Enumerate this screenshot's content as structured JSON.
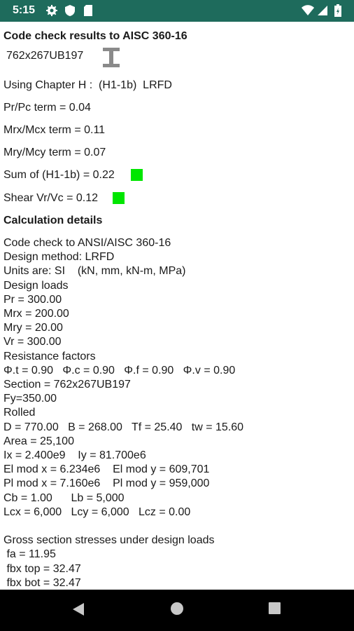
{
  "status_bar": {
    "time": "5:15",
    "background": "#1e6b5c",
    "icons": [
      "gear-icon",
      "shield-icon",
      "sd-card-icon",
      "wifi-icon",
      "signal-icon",
      "battery-icon"
    ]
  },
  "header": {
    "title": "Code check results to AISC 360-16",
    "section_name": "762x267UB197",
    "section_icon": "i-beam-icon"
  },
  "summary": {
    "chapter": "Using Chapter H :  (H1-1b)  LRFD",
    "pr_pc": "Pr/Pc term = 0.04",
    "mrx_mcx": "Mrx/Mcx term = 0.11",
    "mry_mcy": "Mry/Mcy term = 0.07",
    "sum": "Sum of (H1-1b) = 0.22",
    "shear": "Shear Vr/Vc = 0.12",
    "pass_color": "#00e600"
  },
  "details": {
    "title": "Calculation details",
    "lines": [
      "Code check to ANSI/AISC 360-16",
      "Design method: LRFD",
      "Units are: SI    (kN, mm, kN-m, MPa)",
      "Design loads",
      "Pr = 300.00",
      "Mrx = 200.00",
      "Mry = 20.00",
      "Vr = 300.00",
      "Resistance factors",
      "Φ.t = 0.90   Φ.c = 0.90   Φ.f = 0.90   Φ.v = 0.90",
      "Section = 762x267UB197",
      "Fy=350.00",
      "Rolled",
      "D = 770.00   B = 268.00   Tf = 25.40   tw = 15.60",
      "Area = 25,100",
      "Ix = 2.400e9    Iy = 81.700e6",
      "El mod x = 6.234e6    El mod y = 609,701",
      "Pl mod x = 7.160e6    Pl mod y = 959,000",
      "Cb = 1.00      Lb = 5,000",
      "Lcx = 6,000   Lcy = 6,000   Lcz = 0.00",
      "",
      "Gross section stresses under design loads",
      " fa = 11.95",
      " fbx top = 32.47",
      " fbx bot = 32.47"
    ]
  },
  "nav_bar": {
    "buttons": [
      "back-icon",
      "home-icon",
      "recents-icon"
    ]
  }
}
